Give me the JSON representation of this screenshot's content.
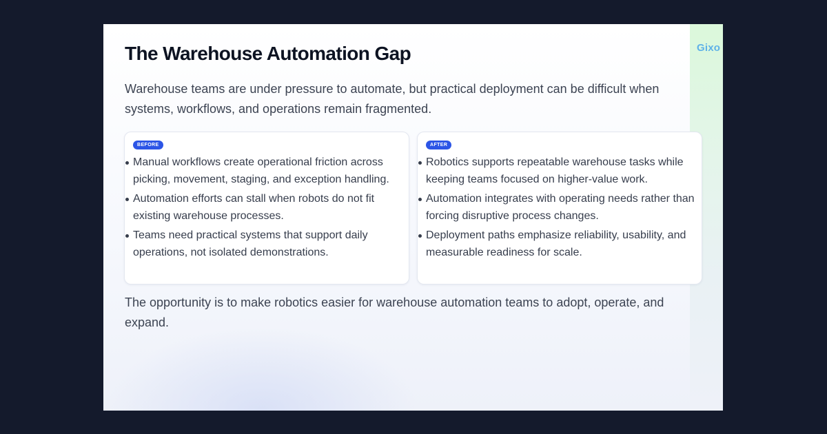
{
  "slide": {
    "brand": "Gixo",
    "title": "The Warehouse Automation Gap",
    "intro": "Warehouse teams are under pressure to automate, but practical deployment can be difficult when systems, workflows, and operations remain fragmented.",
    "before": {
      "badge": "BEFORE",
      "items": [
        "Manual workflows create operational friction across picking, movement, staging, and exception handling.",
        "Automation efforts can stall when robots do not fit existing warehouse processes.",
        "Teams need practical systems that support daily operations, not isolated demonstrations."
      ]
    },
    "after": {
      "badge": "AFTER",
      "items": [
        "Robotics supports repeatable warehouse tasks while keeping teams focused on higher-value work.",
        "Automation integrates with operating needs rather than forcing disruptive process changes.",
        "Deployment paths emphasize reliability, usability, and measurable readiness for scale."
      ]
    },
    "outro": "The opportunity is to make robotics easier for warehouse automation teams to adopt, operate, and expand."
  },
  "colors": {
    "page_background": "#141a2c",
    "badge": "#2c55e6",
    "brand": "#5fb2e8",
    "title": "#0d1322",
    "body_text": "#3c4352"
  }
}
